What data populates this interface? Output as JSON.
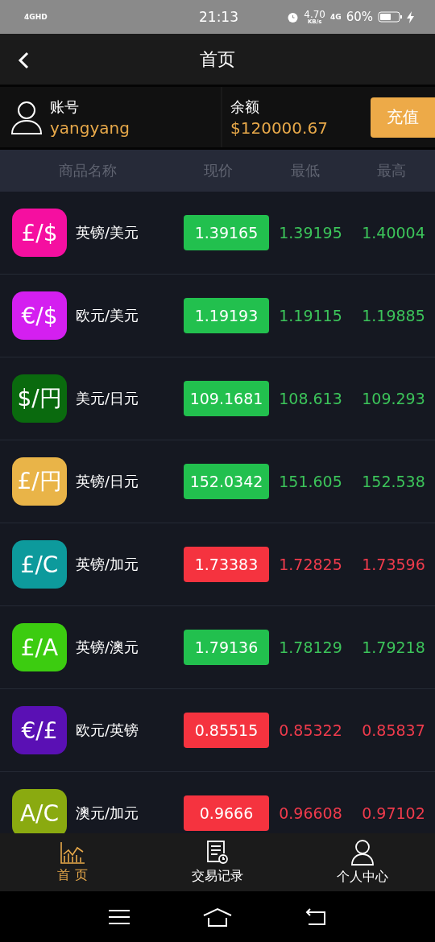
{
  "status_bar": {
    "network": "4GHD",
    "time": "21:13",
    "speed": "4.70",
    "speed_unit": "KB/s",
    "network_2": "4G",
    "battery": "60%"
  },
  "header": {
    "title": "首页"
  },
  "account": {
    "label": "账号",
    "username": "yangyang",
    "balance_label": "余额",
    "balance": "$120000.67",
    "recharge_button": "充值"
  },
  "columns": [
    "商品名称",
    "现价",
    "最低",
    "最高"
  ],
  "rows": [
    {
      "symbol": "£/$",
      "color": "#f50fa0",
      "name": "英镑/美元",
      "price": "1.39165",
      "low": "1.39195",
      "high": "1.40004",
      "rising": true
    },
    {
      "symbol": "€/$",
      "color": "#d41ff0",
      "name": "欧元/美元",
      "price": "1.19193",
      "low": "1.19115",
      "high": "1.19885",
      "rising": true
    },
    {
      "symbol": "$/円",
      "color": "#0a6a0e",
      "name": "美元/日元",
      "price": "109.1681",
      "low": "108.613",
      "high": "109.293",
      "rising": true
    },
    {
      "symbol": "£/円",
      "color": "#e9b448",
      "name": "英镑/日元",
      "price": "152.0342",
      "low": "151.605",
      "high": "152.538",
      "rising": true
    },
    {
      "symbol": "£/C",
      "color": "#0d9a9c",
      "name": "英镑/加元",
      "price": "1.73383",
      "low": "1.72825",
      "high": "1.73596",
      "rising": false
    },
    {
      "symbol": "£/A",
      "color": "#3ccc10",
      "name": "英镑/澳元",
      "price": "1.79136",
      "low": "1.78129",
      "high": "1.79218",
      "rising": true
    },
    {
      "symbol": "€/£",
      "color": "#5a10b4",
      "name": "欧元/英镑",
      "price": "0.85515",
      "low": "0.85322",
      "high": "0.85837",
      "rising": false
    },
    {
      "symbol": "A/C",
      "color": "#8aaa10",
      "name": "澳元/加元",
      "price": "0.9666",
      "low": "0.96608",
      "high": "0.97102",
      "rising": false
    }
  ],
  "tab_bar": [
    {
      "label": "首 页",
      "selected": true,
      "kind": "chart"
    },
    {
      "label": "交易记录",
      "selected": false,
      "kind": "record"
    },
    {
      "label": "个人中心",
      "selected": false,
      "kind": "person"
    }
  ]
}
